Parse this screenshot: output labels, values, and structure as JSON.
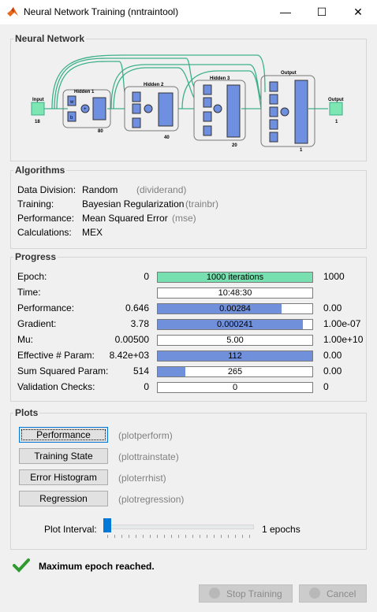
{
  "window": {
    "title": "Neural Network Training (nntraintool)",
    "minimize_glyph": "—",
    "maximize_glyph": "☐",
    "close_glyph": "✕"
  },
  "network": {
    "section_label": "Neural Network",
    "input_label": "Input",
    "input_size": "18",
    "hidden1_label": "Hidden 1",
    "hidden1_size": "80",
    "hidden2_label": "Hidden 2",
    "hidden2_size": "40",
    "hidden3_label": "Hidden 3",
    "hidden3_size": "20",
    "output_layer_label": "Output",
    "output_layer_size": "1",
    "output_label": "Output",
    "output_size": "1",
    "w_glyph": "w",
    "b_glyph": "b",
    "sum_glyph": "+"
  },
  "algorithms": {
    "section_label": "Algorithms",
    "rows": [
      {
        "label": "Data Division:",
        "value": "Random",
        "fn": "(dividerand)"
      },
      {
        "label": "Training:",
        "value": "Bayesian Regularization",
        "fn": "(trainbr)"
      },
      {
        "label": "Performance:",
        "value": "Mean Squared Error",
        "fn": "(mse)"
      },
      {
        "label": "Calculations:",
        "value": "MEX",
        "fn": ""
      }
    ]
  },
  "progress": {
    "section_label": "Progress",
    "rows": [
      {
        "label": "Epoch:",
        "start": "0",
        "bar": "1000 iterations",
        "end": "1000",
        "fill": 1.0
      },
      {
        "label": "Time:",
        "start": "",
        "bar": "10:48:30",
        "end": "",
        "fill": 0
      },
      {
        "label": "Performance:",
        "start": "0.646",
        "bar": "0.00284",
        "end": "0.00",
        "fill": 0.8
      },
      {
        "label": "Gradient:",
        "start": "3.78",
        "bar": "0.000241",
        "end": "1.00e-07",
        "fill": 0.94
      },
      {
        "label": "Mu:",
        "start": "0.00500",
        "bar": "5.00",
        "end": "1.00e+10",
        "fill": 0
      },
      {
        "label": "Effective # Param:",
        "start": "8.42e+03",
        "bar": "112",
        "end": "0.00",
        "fill": 1.0
      },
      {
        "label": "Sum Squared Param:",
        "start": "514",
        "bar": "265",
        "end": "0.00",
        "fill": 0.18
      },
      {
        "label": "Validation Checks:",
        "start": "0",
        "bar": "0",
        "end": "0",
        "fill": 0
      }
    ]
  },
  "plots": {
    "section_label": "Plots",
    "buttons": [
      {
        "label": "Performance",
        "fn": "(plotperform)"
      },
      {
        "label": "Training State",
        "fn": "(plottrainstate)"
      },
      {
        "label": "Error Histogram",
        "fn": "(ploterrhist)"
      },
      {
        "label": "Regression",
        "fn": "(plotregression)"
      }
    ],
    "interval_label": "Plot Interval:",
    "interval_value": "1 epochs",
    "interval_fraction": 0.0
  },
  "status": {
    "message": "Maximum epoch reached.",
    "check_glyph": "✔"
  },
  "footer": {
    "stop_label": "Stop Training",
    "cancel_label": "Cancel"
  },
  "colors": {
    "accent": "#0078d7",
    "progress_fill": "#7090dc",
    "epoch_fill": "#78e0b0",
    "node": "#6f8fe0",
    "network_line": "#3cb08a"
  }
}
